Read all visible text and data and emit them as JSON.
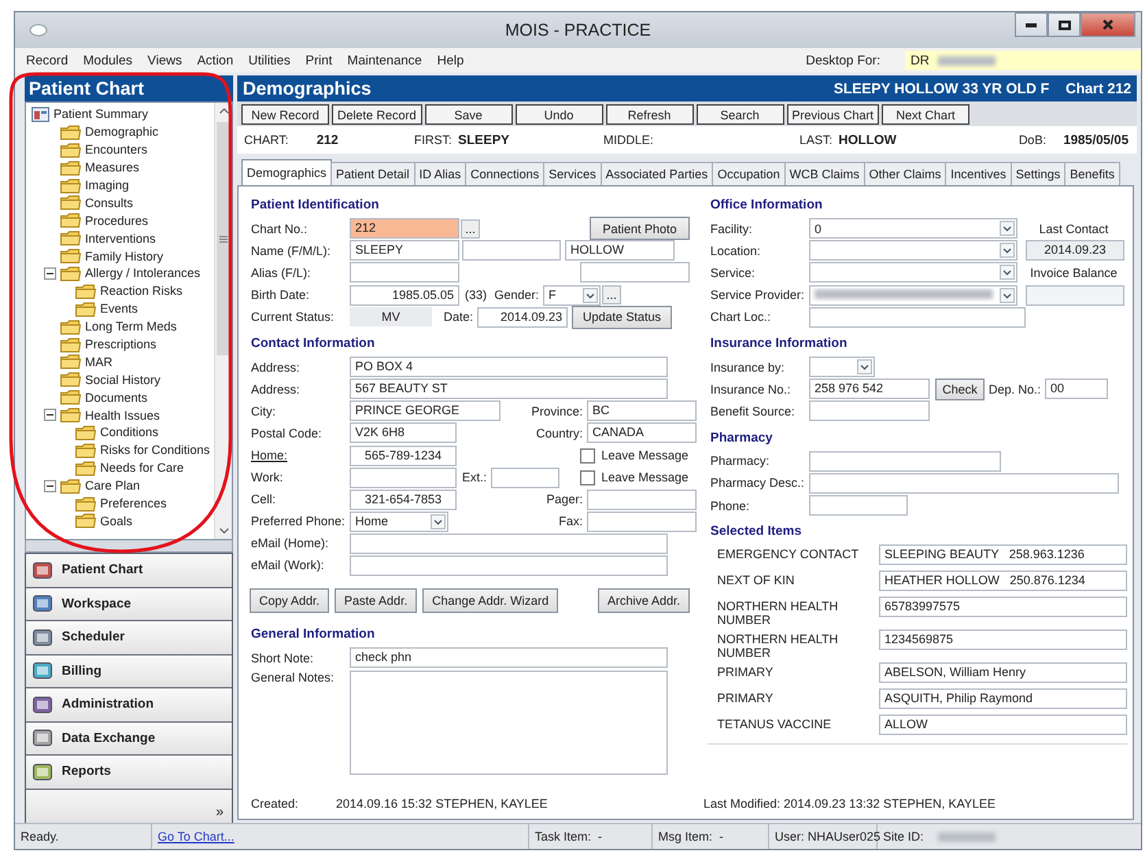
{
  "window": {
    "title": "MOIS - PRACTICE"
  },
  "menu": [
    "Record",
    "Modules",
    "Views",
    "Action",
    "Utilities",
    "Print",
    "Maintenance",
    "Help"
  ],
  "desktop_for": {
    "label": "Desktop For:",
    "value": "DR"
  },
  "sidebar": {
    "title": "Patient Chart",
    "tree": [
      {
        "label": "Patient Summary",
        "children": [
          {
            "label": "Demographic"
          },
          {
            "label": "Encounters"
          },
          {
            "label": "Measures"
          },
          {
            "label": "Imaging"
          },
          {
            "label": "Consults"
          },
          {
            "label": "Procedures"
          },
          {
            "label": "Interventions"
          },
          {
            "label": "Family History"
          },
          {
            "label": "Allergy / Intolerances",
            "expanded": true,
            "children": [
              {
                "label": "Reaction Risks"
              },
              {
                "label": "Events"
              }
            ]
          },
          {
            "label": "Long Term Meds"
          },
          {
            "label": "Prescriptions"
          },
          {
            "label": "MAR"
          },
          {
            "label": "Social History"
          },
          {
            "label": "Documents"
          },
          {
            "label": "Health Issues",
            "expanded": true,
            "children": [
              {
                "label": "Conditions"
              },
              {
                "label": "Risks for Conditions"
              },
              {
                "label": "Needs for Care"
              }
            ]
          },
          {
            "label": "Care Plan",
            "expanded": true,
            "children": [
              {
                "label": "Preferences"
              },
              {
                "label": "Goals"
              }
            ]
          }
        ]
      }
    ],
    "nav": [
      "Patient Chart",
      "Workspace",
      "Scheduler",
      "Billing",
      "Administration",
      "Data Exchange",
      "Reports"
    ],
    "more": "»"
  },
  "panel": {
    "title": "Demographics",
    "patient": "SLEEPY HOLLOW 33 YR OLD F",
    "chart": "Chart 212"
  },
  "toolbar": [
    "New Record",
    "Delete Record",
    "Save",
    "Undo",
    "Refresh",
    "Search",
    "Previous Chart",
    "Next Chart"
  ],
  "chart_info": [
    {
      "label": "CHART:",
      "value": "212"
    },
    {
      "label": "FIRST:",
      "value": "SLEEPY"
    },
    {
      "label": "MIDDLE:"
    },
    {
      "label": "LAST:",
      "value": "HOLLOW"
    },
    {
      "label": "DoB:",
      "value": "1985/05/05"
    }
  ],
  "tabs": [
    {
      "label": "Demographics",
      "selected": true
    },
    {
      "label": "Patient Detail",
      "selected": false
    },
    {
      "label": "ID Alias",
      "selected": false
    },
    {
      "label": "Connections",
      "selected": false
    },
    {
      "label": "Services",
      "selected": false
    },
    {
      "label": "Associated Parties",
      "selected": false
    },
    {
      "label": "Occupation",
      "selected": false
    },
    {
      "label": "WCB Claims",
      "selected": false
    },
    {
      "label": "Other Claims",
      "selected": false
    },
    {
      "label": "Incentives",
      "selected": false
    },
    {
      "label": "Settings",
      "selected": false
    },
    {
      "label": "Benefits",
      "selected": false
    }
  ],
  "identification": {
    "title": "Patient Identification",
    "chart_no": {
      "label": "Chart No.:",
      "value": "212",
      "more": "..."
    },
    "photo_button": "Patient Photo",
    "name": {
      "label": "Name (F/M/L):",
      "first": "SLEEPY",
      "last": "HOLLOW"
    },
    "alias": {
      "label": "Alias (F/L):"
    },
    "birth": {
      "label": "Birth Date:",
      "value": "1985.05.05",
      "age": "(33)"
    },
    "gender": {
      "label": "Gender:",
      "value": "F",
      "more": "..."
    },
    "status": {
      "label": "Current Status:",
      "value": "MV"
    },
    "date": {
      "label": "Date:",
      "value": "2014.09.23"
    },
    "update_button": "Update Status"
  },
  "contact": {
    "title": "Contact Information",
    "address_1": {
      "label": "Address:",
      "value": "PO BOX 4"
    },
    "address_2": {
      "label": "Address:",
      "value": "567 BEAUTY ST"
    },
    "city": {
      "label": "City:",
      "value": "PRINCE GEORGE"
    },
    "province": {
      "label": "Province:",
      "value": "BC"
    },
    "postal_code": {
      "label": "Postal Code:",
      "value": "V2K 6H8"
    },
    "country": {
      "label": "Country:",
      "value": "CANADA"
    },
    "home": {
      "label": "Home:",
      "value": "565-789-1234",
      "leave_message": {
        "label": "Leave Message",
        "checked": false
      }
    },
    "work": {
      "label": "Work:",
      "leave_message": {
        "label": "Leave Message",
        "checked": false
      }
    },
    "ext": {
      "label": "Ext.:"
    },
    "cell": {
      "label": "Cell:",
      "value": "321-654-7853"
    },
    "pager": {
      "label": "Pager:"
    },
    "preferred_phone": {
      "label": "Preferred Phone:",
      "value": "Home"
    },
    "fax": {
      "label": "Fax:"
    },
    "email_home": {
      "label": "eMail (Home):"
    },
    "email_work": {
      "label": "eMail (Work):"
    }
  },
  "address_buttons": [
    "Copy Addr.",
    "Paste Addr.",
    "Change Addr. Wizard",
    "Archive Addr."
  ],
  "general": {
    "title": "General Information",
    "short_note": {
      "label": "Short Note:",
      "value": "check phn"
    },
    "general_notes": {
      "label": "General Notes:"
    }
  },
  "created": {
    "label": "Created:",
    "value": "2014.09.16 15:32 STEPHEN, KAYLEE"
  },
  "last_modified": {
    "label": "Last Modified:",
    "value": "2014.09.23 13:32 STEPHEN, KAYLEE"
  },
  "office": {
    "title": "Office Information",
    "facility": {
      "label": "Facility:",
      "value": "0"
    },
    "location": {
      "label": "Location:"
    },
    "service": {
      "label": "Service:"
    },
    "service_provider": {
      "label": "Service Provider:"
    },
    "chart_loc": {
      "label": "Chart Loc.:"
    },
    "last_contact": {
      "label": "Last Contact",
      "value": "2014.09.23"
    },
    "invoice_balance": {
      "label": "Invoice Balance"
    }
  },
  "insurance": {
    "title": "Insurance Information",
    "insurance_by": {
      "label": "Insurance by:"
    },
    "insurance_no": {
      "label": "Insurance No.:",
      "value": "258 976 542"
    },
    "check_button": "Check",
    "dep_no": {
      "label": "Dep. No.:",
      "value": "00"
    },
    "benefit_source": {
      "label": "Benefit Source:"
    }
  },
  "pharmacy": {
    "title": "Pharmacy",
    "pharmacy": {
      "label": "Pharmacy:"
    },
    "description": {
      "label": "Pharmacy Desc.:"
    },
    "phone": {
      "label": "Phone:"
    }
  },
  "selected_items": {
    "title": "Selected Items",
    "items": [
      {
        "label": "EMERGENCY CONTACT",
        "value": "SLEEPING BEAUTY   258.963.1236"
      },
      {
        "label": "NEXT OF KIN",
        "value": "HEATHER HOLLOW   250.876.1234"
      },
      {
        "label": "NORTHERN HEALTH NUMBER",
        "value": "65783997575"
      },
      {
        "label": "NORTHERN HEALTH NUMBER",
        "value": "1234569875"
      },
      {
        "label": "PRIMARY",
        "value": "ABELSON, William Henry"
      },
      {
        "label": "PRIMARY",
        "value": "ASQUITH, Philip Raymond"
      },
      {
        "label": "TETANUS VACCINE",
        "value": "ALLOW"
      }
    ]
  },
  "status_bar": {
    "status": "Ready.",
    "link": "Go To Chart...",
    "task_item": "Task Item:  -",
    "msg_item": "Msg Item:  -",
    "user": "User: NHAUser025",
    "site_id": "Site ID:"
  }
}
